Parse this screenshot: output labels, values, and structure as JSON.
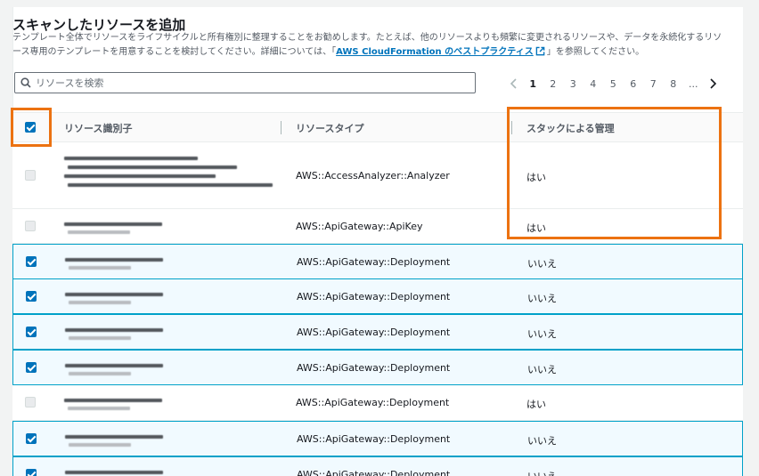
{
  "section": {
    "title": "スキャンしたリソースを追加",
    "description_part1": "テンプレート全体でリソースをライフサイクルと所有権別に整理することをお勧めします。たとえば、他のリソースよりも頻繁に変更されるリソースや、データを永続化するリソース専用のテンプレートを用意することを検討してください。詳細については、「",
    "link_text": "AWS CloudFormation のベストプラクティス",
    "description_part2": "」を参照してください。"
  },
  "search": {
    "placeholder": "リソースを検索",
    "value": ""
  },
  "pagination": {
    "pages": [
      "1",
      "2",
      "3",
      "4",
      "5",
      "6",
      "7",
      "8",
      "..."
    ],
    "current": "1"
  },
  "table": {
    "headers": {
      "identifier": "リソース識別子",
      "type": "リソースタイプ",
      "managed": "スタックによる管理"
    },
    "select_all_checked": true,
    "rows": [
      {
        "type": "AWS::AccessAnalyzer::Analyzer",
        "managed": "はい",
        "selected": false
      },
      {
        "type": "AWS::ApiGateway::ApiKey",
        "managed": "はい",
        "selected": false
      },
      {
        "type": "AWS::ApiGateway::Deployment",
        "managed": "いいえ",
        "selected": true
      },
      {
        "type": "AWS::ApiGateway::Deployment",
        "managed": "いいえ",
        "selected": true
      },
      {
        "type": "AWS::ApiGateway::Deployment",
        "managed": "いいえ",
        "selected": true
      },
      {
        "type": "AWS::ApiGateway::Deployment",
        "managed": "いいえ",
        "selected": true
      },
      {
        "type": "AWS::ApiGateway::Deployment",
        "managed": "はい",
        "selected": false
      },
      {
        "type": "AWS::ApiGateway::Deployment",
        "managed": "いいえ",
        "selected": true
      },
      {
        "type": "AWS::ApiGateway::Deployment",
        "managed": "いいえ",
        "selected": true
      }
    ]
  },
  "colors": {
    "accent": "#0073bb",
    "highlight": "#ec7211",
    "selected_row_border": "#00a1c9",
    "selected_row_bg": "#f1faff"
  },
  "icons": {
    "search": "search-icon",
    "external_link": "external-link-icon",
    "prev": "chevron-left-icon",
    "next": "chevron-right-icon"
  }
}
